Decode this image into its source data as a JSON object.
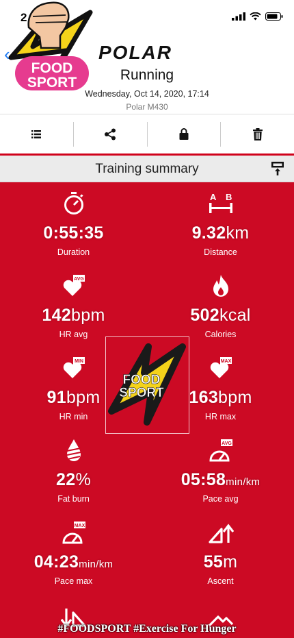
{
  "statusbar": {
    "time": "2"
  },
  "header": {
    "brand": "POLAR",
    "title": "Running",
    "date": "Wednesday, Oct 14, 2020, 17:14",
    "device": "Polar M430"
  },
  "summary": {
    "title": "Training summary"
  },
  "stats": {
    "duration": {
      "value": "0:55:35",
      "unit": "",
      "label": "Duration"
    },
    "distance": {
      "value": "9.32",
      "unit": "km",
      "label": "Distance",
      "badge_a": "A",
      "badge_b": "B"
    },
    "hr_avg": {
      "value": "142",
      "unit": "bpm",
      "label": "HR avg",
      "badge": "AVG"
    },
    "calories": {
      "value": "502",
      "unit": "kcal",
      "label": "Calories"
    },
    "hr_min": {
      "value": "91",
      "unit": "bpm",
      "label": "HR min",
      "badge": "MIN"
    },
    "hr_max": {
      "value": "163",
      "unit": "bpm",
      "label": "HR max",
      "badge": "MAX"
    },
    "fat_burn": {
      "value": "22",
      "unit": "%",
      "label": "Fat burn"
    },
    "pace_avg": {
      "value": "05:58",
      "unit": "min/km",
      "label": "Pace avg",
      "badge": "AVG"
    },
    "pace_max": {
      "value": "04:23",
      "unit": "min/km",
      "label": "Pace max",
      "badge": "MAX"
    },
    "ascent": {
      "value": "55",
      "unit": "m",
      "label": "Ascent"
    }
  },
  "overlay": {
    "logo_line1": "FOOD",
    "logo_line2": "SPORT",
    "footer": "#FOODSPORT #Exercise For Hunger"
  },
  "colors": {
    "red": "#cc0a24",
    "accent_blue": "#1e7bf5",
    "logo_pink": "#e63b8f",
    "logo_yellow": "#f5d31a"
  }
}
